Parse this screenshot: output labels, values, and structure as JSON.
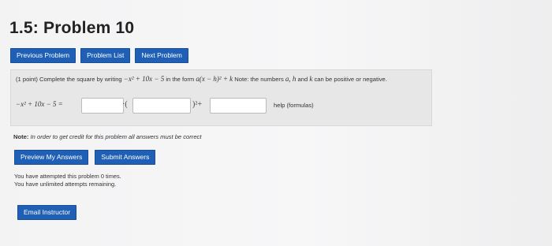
{
  "page": {
    "title": "1.5: Problem 10"
  },
  "nav": {
    "previous": "Previous Problem",
    "list": "Problem List",
    "next": "Next Problem"
  },
  "problem": {
    "prompt_prefix": "(1 point) Complete the square by writing",
    "prompt_expr": "−x² + 10x − 5",
    "prompt_mid": "in the form",
    "prompt_form": "a(x − h)² + k",
    "prompt_note": "Note: the numbers",
    "vars": "a, h",
    "and": "and",
    "k": "k",
    "prompt_tail": "can be positive or negative.",
    "answer_expr": "−x² + 10x − 5 =",
    "mult_sym": "·(",
    "close_sym": ")²+",
    "help_text": "help (formulas)",
    "answers": {
      "a": "",
      "h": "",
      "k": ""
    }
  },
  "note": {
    "label": "Note:",
    "text": "In order to get credit for this problem all answers must be correct"
  },
  "actions": {
    "preview": "Preview My Answers",
    "submit": "Submit Answers"
  },
  "status": {
    "attempts": "You have attempted this problem 0 times.",
    "remaining": "You have unlimited attempts remaining."
  },
  "footer": {
    "email": "Email Instructor"
  },
  "colors": {
    "button": "#1f5fb6",
    "panel": "#e6e7e6"
  }
}
